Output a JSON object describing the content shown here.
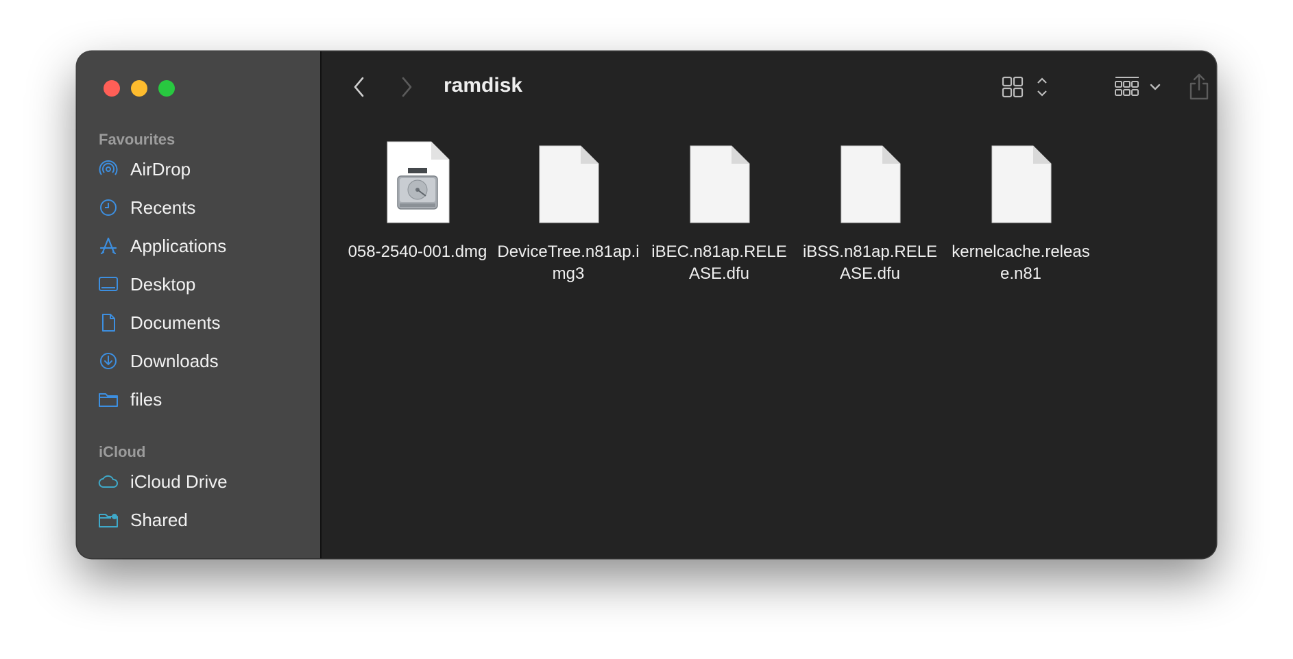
{
  "window": {
    "title": "ramdisk"
  },
  "sidebar": {
    "sections": [
      {
        "title": "Favourites"
      },
      {
        "title": "iCloud"
      }
    ],
    "items": [
      {
        "label": "AirDrop",
        "icon": "airdrop-icon"
      },
      {
        "label": "Recents",
        "icon": "clock-icon"
      },
      {
        "label": "Applications",
        "icon": "applications-icon"
      },
      {
        "label": "Desktop",
        "icon": "desktop-icon"
      },
      {
        "label": "Documents",
        "icon": "document-icon"
      },
      {
        "label": "Downloads",
        "icon": "download-icon"
      },
      {
        "label": "files",
        "icon": "folder-icon"
      },
      {
        "label": "iCloud Drive",
        "icon": "cloud-icon"
      },
      {
        "label": "Shared",
        "icon": "shared-folder-icon"
      }
    ]
  },
  "toolbar": {
    "icons": [
      "back-icon",
      "forward-icon",
      "icon-view-icon",
      "group-icon",
      "share-icon",
      "tag-icon",
      "more-icon",
      "search-icon"
    ]
  },
  "files": [
    {
      "name": "058-2540-001.dmg",
      "icon": "disk-image-icon"
    },
    {
      "name": "DeviceTree.n81ap.img3",
      "icon": "generic-file-icon"
    },
    {
      "name": "iBEC.n81ap.RELEASE.dfu",
      "icon": "generic-file-icon"
    },
    {
      "name": "iBSS.n81ap.RELEASE.dfu",
      "icon": "generic-file-icon"
    },
    {
      "name": "kernelcache.release.n81",
      "icon": "generic-file-icon"
    }
  ],
  "colors": {
    "accent": "#3d8fe0",
    "sidebar_bg": "#464646",
    "content_bg": "#232323"
  }
}
